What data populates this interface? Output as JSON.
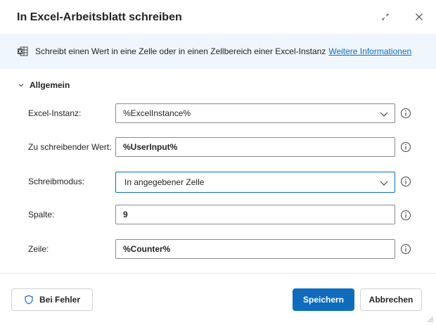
{
  "dialog": {
    "title": "In Excel-Arbeitsblatt schreiben"
  },
  "info": {
    "description": "Schreibt einen Wert in eine Zelle oder in einen Zellbereich einer Excel-Instanz",
    "link": "Weitere Informationen"
  },
  "section": {
    "label": "Allgemein"
  },
  "fields": {
    "excel_instance": {
      "label": "Excel-Instanz:",
      "value": "%ExcelInstance%"
    },
    "value_to_write": {
      "label": "Zu schreibender Wert:",
      "value": "%UserInput%"
    },
    "write_mode": {
      "label": "Schreibmodus:",
      "value": "In angegebener Zelle"
    },
    "column": {
      "label": "Spalte:",
      "value": "9"
    },
    "row": {
      "label": "Zeile:",
      "value": "%Counter%"
    }
  },
  "footer": {
    "on_error": "Bei Fehler",
    "save": "Speichern",
    "cancel": "Abbrechen"
  },
  "colors": {
    "accent": "#0f6cbd",
    "info_bg": "#eff6fc",
    "excel_green": "#107c41"
  }
}
